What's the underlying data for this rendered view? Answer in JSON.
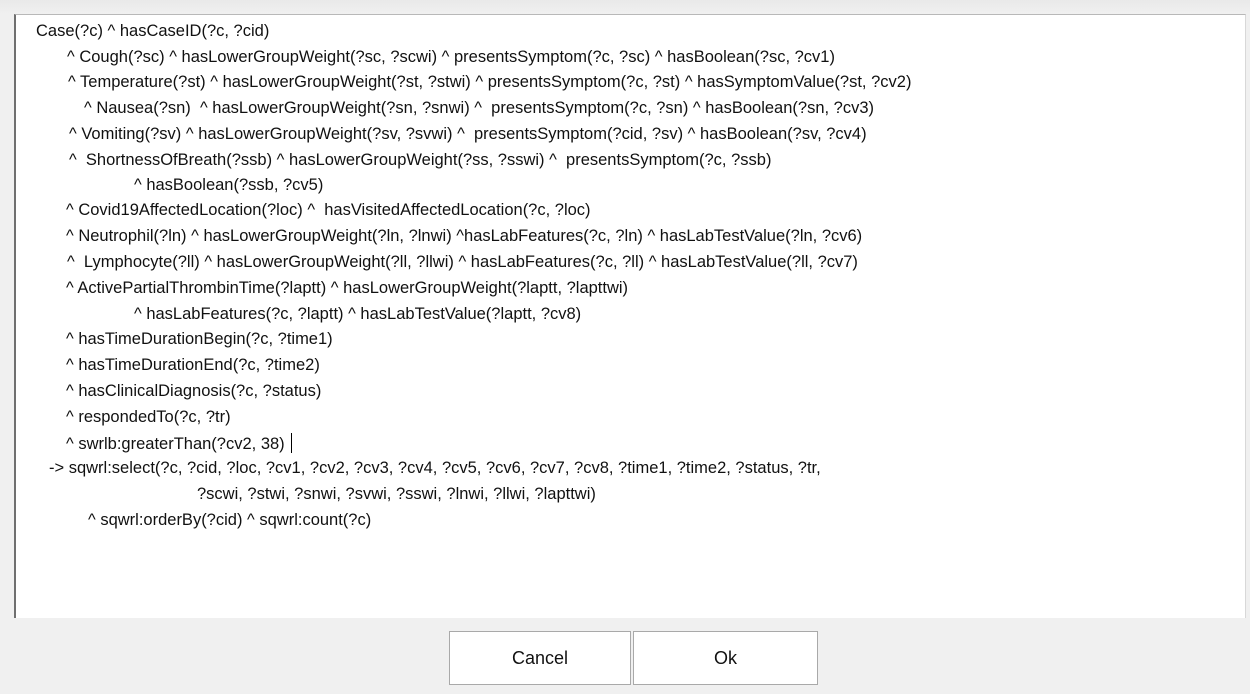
{
  "editor": {
    "lines": [
      "Case(?c) ^ hasCaseID(?c, ?cid)",
      "^ Cough(?sc) ^ hasLowerGroupWeight(?sc, ?scwi) ^ presentsSymptom(?c, ?sc) ^ hasBoolean(?sc, ?cv1)",
      "^ Temperature(?st) ^ hasLowerGroupWeight(?st, ?stwi) ^ presentsSymptom(?c, ?st) ^ hasSymptomValue(?st, ?cv2)",
      "^ Nausea(?sn)  ^ hasLowerGroupWeight(?sn, ?snwi) ^  presentsSymptom(?c, ?sn) ^ hasBoolean(?sn, ?cv3)",
      "^ Vomiting(?sv) ^ hasLowerGroupWeight(?sv, ?svwi) ^  presentsSymptom(?cid, ?sv) ^ hasBoolean(?sv, ?cv4)",
      "^  ShortnessOfBreath(?ssb) ^ hasLowerGroupWeight(?ss, ?sswi) ^  presentsSymptom(?c, ?ssb)",
      "^ hasBoolean(?ssb, ?cv5)",
      "^ Covid19AffectedLocation(?loc) ^  hasVisitedAffectedLocation(?c, ?loc)",
      "^ Neutrophil(?ln) ^ hasLowerGroupWeight(?ln, ?lnwi) ^hasLabFeatures(?c, ?ln) ^ hasLabTestValue(?ln, ?cv6)",
      "^  Lymphocyte(?ll) ^ hasLowerGroupWeight(?ll, ?llwi) ^ hasLabFeatures(?c, ?ll) ^ hasLabTestValue(?ll, ?cv7)",
      "^ ActivePartialThrombinTime(?laptt) ^ hasLowerGroupWeight(?laptt, ?lapttwi)",
      "^ hasLabFeatures(?c, ?laptt) ^ hasLabTestValue(?laptt, ?cv8)",
      "^ hasTimeDurationBegin(?c, ?time1)",
      "^ hasTimeDurationEnd(?c, ?time2)",
      "^ hasClinicalDiagnosis(?c, ?status)",
      "^ respondedTo(?c, ?tr)",
      "^ swrlb:greaterThan(?cv2, 38)",
      "-> sqwrl:select(?c, ?cid, ?loc, ?cv1, ?cv2, ?cv3, ?cv4, ?cv5, ?cv6, ?cv7, ?cv8, ?time1, ?time2, ?status, ?tr,",
      "?scwi, ?stwi, ?snwi, ?svwi, ?sswi, ?lnwi, ?llwi, ?lapttwi)",
      "^ sqwrl:orderBy(?cid) ^ sqwrl:count(?c)"
    ]
  },
  "buttons": {
    "cancel": "Cancel",
    "ok": "Ok"
  }
}
